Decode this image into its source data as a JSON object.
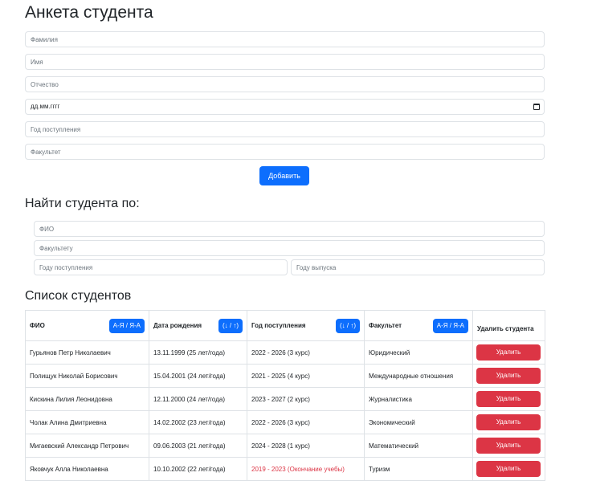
{
  "form": {
    "title": "Анкета студента",
    "surname_placeholder": "Фамилия",
    "name_placeholder": "Имя",
    "patronymic_placeholder": "Отчество",
    "birthdate_value": "дд.мм.гггг",
    "admission_year_placeholder": "Год поступления",
    "faculty_placeholder": "Факультет",
    "add_label": "Добавить"
  },
  "search": {
    "title": "Найти студента по:",
    "fio_placeholder": "ФИО",
    "faculty_placeholder": "Факультету",
    "admission_year_placeholder": "Году поступления",
    "graduation_year_placeholder": "Году выпуска"
  },
  "list": {
    "title": "Список студентов",
    "headers": {
      "fio": "ФИО",
      "birthdate": "Дата рождения",
      "admission": "Год поступления",
      "faculty": "Факультет",
      "delete": "Удалить студента"
    },
    "sort_labels": {
      "fio": "А-Я / Я-А",
      "birthdate": "(↓ / ↑)",
      "admission": "(↓ / ↑)",
      "faculty": "А-Я / Я-А"
    },
    "delete_label": "Удалить",
    "rows": [
      {
        "fio": "Гурьянов Петр Николаевич",
        "birthdate": "13.11.1999 (25 лет/года)",
        "years": "2022 - 2026 (3 курс)",
        "faculty": "Юридический"
      },
      {
        "fio": "Полищук Николай Борисович",
        "birthdate": "15.04.2001 (24 лет/года)",
        "years": "2021 - 2025 (4 курс)",
        "faculty": "Международные отношения"
      },
      {
        "fio": "Кискина Лилия Леонидовна",
        "birthdate": "12.11.2000 (24 лет/года)",
        "years": "2023 - 2027 (2 курс)",
        "faculty": "Журналистика"
      },
      {
        "fio": "Чолак Алина Дмитриевна",
        "birthdate": "14.02.2002 (23 лет/года)",
        "years": "2022 - 2026 (3 курс)",
        "faculty": "Экономический"
      },
      {
        "fio": "Мигаевский Александр Петрович",
        "birthdate": "09.06.2003 (21 лет/года)",
        "years": "2024 - 2028 (1 курс)",
        "faculty": "Математический"
      },
      {
        "fio": "Яковчук Алла Николаевна",
        "birthdate": "10.10.2002 (22 лет/года)",
        "years": "2019 - 2023 (Окончание учебы)",
        "faculty": "Туризм"
      }
    ]
  },
  "colors": {
    "primary": "#0d6efd",
    "danger": "#dc3545",
    "border": "#dee2e6"
  }
}
